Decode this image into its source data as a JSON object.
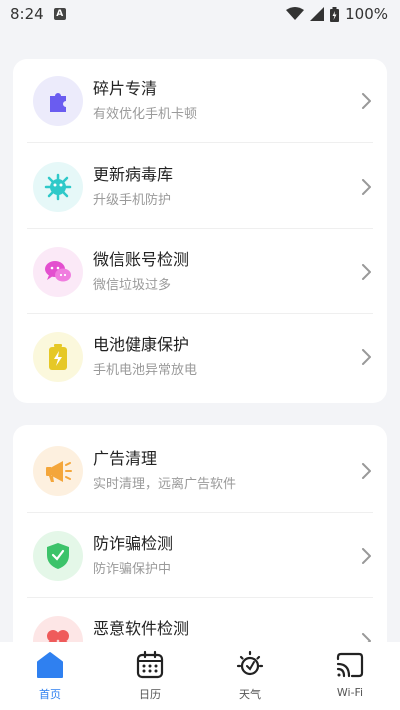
{
  "status_bar": {
    "time": "8:24",
    "battery": "100%"
  },
  "section1": [
    {
      "title": "碎片专清",
      "subtitle": "有效优化手机卡顿"
    },
    {
      "title": "更新病毒库",
      "subtitle": "升级手机防护"
    },
    {
      "title": "微信账号检测",
      "subtitle": "微信垃圾过多"
    },
    {
      "title": "电池健康保护",
      "subtitle": "手机电池异常放电"
    }
  ],
  "section2": [
    {
      "title": "广告清理",
      "subtitle": "实时清理，远离广告软件"
    },
    {
      "title": "防诈骗检测",
      "subtitle": "防诈骗保护中"
    },
    {
      "title": "恶意软件检测",
      "subtitle": ""
    }
  ],
  "nav": [
    {
      "label": "首页",
      "icon": "home-icon",
      "active": true
    },
    {
      "label": "日历",
      "icon": "calendar-icon"
    },
    {
      "label": "天气",
      "icon": "weather-icon"
    },
    {
      "label": "Wi-Fi",
      "icon": "cast-icon"
    }
  ],
  "colors": {
    "accent": "#2f80f0"
  }
}
